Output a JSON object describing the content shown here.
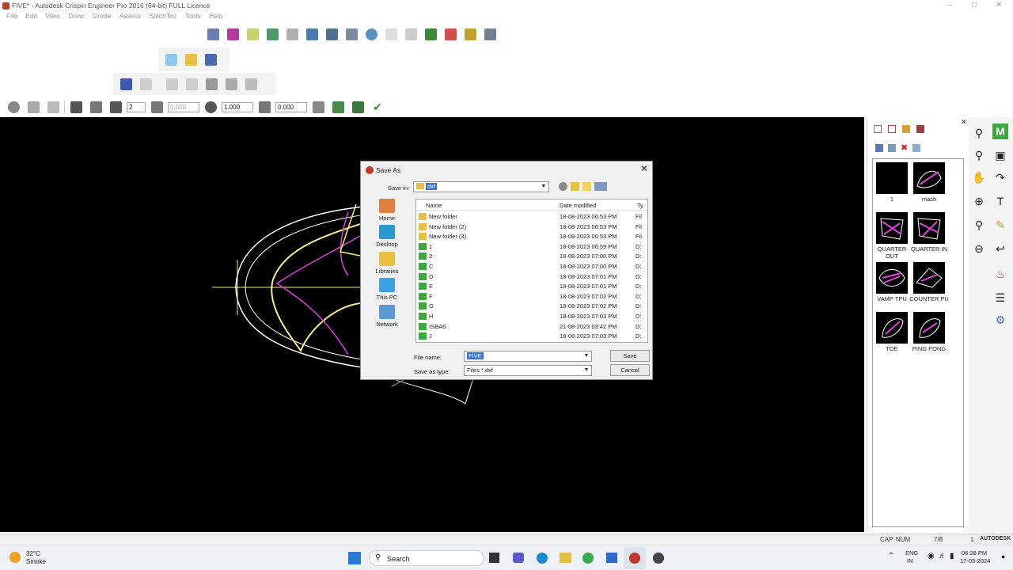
{
  "window": {
    "title": "FIVE* - Autodesk Crispin Engineer Pro 2016 (64-bit)  FULL Licence"
  },
  "menu": [
    "File",
    "Edit",
    "View",
    "Draw",
    "Grade",
    "Assess",
    "StitchTec",
    "Tools",
    "Help"
  ],
  "toolbar": {
    "grid_value": "2",
    "field_a": "0.000",
    "field_b": "1.000",
    "field_c": "0.000"
  },
  "dialog": {
    "title": "Save As",
    "save_in_label": "Save in:",
    "save_in_value": "dxf",
    "columns": {
      "name": "Name",
      "date": "Date modified",
      "type": "Ty"
    },
    "places": [
      "Home",
      "Desktop",
      "Libraries",
      "This PC",
      "Network"
    ],
    "files": [
      {
        "name": "New folder",
        "date": "18-08-2023 06:53 PM",
        "type": "Fil",
        "kind": "folder"
      },
      {
        "name": "New folder (2)",
        "date": "18-08-2023 06:53 PM",
        "type": "Fil",
        "kind": "folder"
      },
      {
        "name": "New folder (3)",
        "date": "18-08-2023 06:53 PM",
        "type": "Fil",
        "kind": "folder"
      },
      {
        "name": "1",
        "date": "18-08-2023 06:59 PM",
        "type": "D:",
        "kind": "dxf"
      },
      {
        "name": "2",
        "date": "18-08-2023 07:00 PM",
        "type": "D:",
        "kind": "dxf"
      },
      {
        "name": "C",
        "date": "18-08-2023 07:00 PM",
        "type": "D:",
        "kind": "dxf"
      },
      {
        "name": "D",
        "date": "18-08-2023 07:01 PM",
        "type": "D:",
        "kind": "dxf"
      },
      {
        "name": "E",
        "date": "18-08-2023 07:01 PM",
        "type": "D:",
        "kind": "dxf"
      },
      {
        "name": "F",
        "date": "18-08-2023 07:02 PM",
        "type": "D:",
        "kind": "dxf"
      },
      {
        "name": "G",
        "date": "18-08-2023 07:02 PM",
        "type": "D:",
        "kind": "dxf"
      },
      {
        "name": "H",
        "date": "18-08-2023 07:03 PM",
        "type": "D:",
        "kind": "dxf"
      },
      {
        "name": "ISBA6",
        "date": "21-08-2023 03:42 PM",
        "type": "D:",
        "kind": "dxf"
      },
      {
        "name": "J",
        "date": "18-08-2023 07:03 PM",
        "type": "D:",
        "kind": "dxf"
      }
    ],
    "filename_label": "File name:",
    "filename_value": "FIVE",
    "savetype_label": "Save as type:",
    "savetype_value": "Files *.dxf",
    "save_button": "Save",
    "cancel_button": "Cancel"
  },
  "pieces": [
    {
      "label": "1"
    },
    {
      "label": "mash"
    },
    {
      "label": "QUARTER OUT"
    },
    {
      "label": "QUARTER IN"
    },
    {
      "label": "VAMP TPU"
    },
    {
      "label": "COUNTER PU"
    },
    {
      "label": "TOE"
    },
    {
      "label": "PING PONG"
    }
  ],
  "status": {
    "cap": "CAP",
    "num": "NUM",
    "page": "7/8",
    "l": "L",
    "brand": "AUTODESK"
  },
  "taskbar": {
    "weather_temp": "32°C",
    "weather_desc": "Smoke",
    "search": "Search",
    "lang1": "ENG",
    "lang2": "IN",
    "time": "06:28 PM",
    "date": "17-05-2024"
  },
  "colors": {
    "canvas": "#000000",
    "accent": "#3a6fd8",
    "piece_pink": "#e040e0",
    "piece_yellow": "#f5f080"
  }
}
